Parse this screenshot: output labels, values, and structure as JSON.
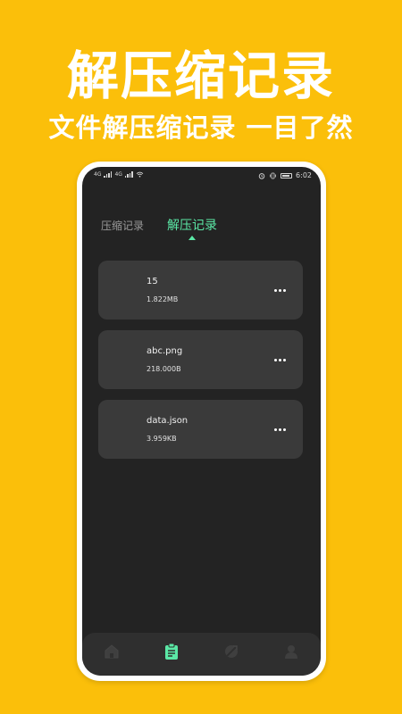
{
  "promo": {
    "headline": "解压缩记录",
    "subline": "文件解压缩记录 一目了然"
  },
  "statusbar": {
    "net_a": "4G",
    "net_b": "4G",
    "time": "6:02"
  },
  "tabs": [
    {
      "label": "压缩记录",
      "active": false
    },
    {
      "label": "解压记录",
      "active": true
    }
  ],
  "records": [
    {
      "name": "15",
      "size": "1.822MB"
    },
    {
      "name": "abc.png",
      "size": "218.000B"
    },
    {
      "name": "data.json",
      "size": "3.959KB"
    }
  ],
  "bottom_nav": [
    {
      "icon": "home-icon",
      "active": false
    },
    {
      "icon": "clipboard-icon",
      "active": true
    },
    {
      "icon": "explore-icon",
      "active": false
    },
    {
      "icon": "user-icon",
      "active": false
    }
  ],
  "colors": {
    "background": "#FBBF0A",
    "accent": "#5BE8A6",
    "screen": "#232323",
    "card": "#3a3a3a"
  }
}
